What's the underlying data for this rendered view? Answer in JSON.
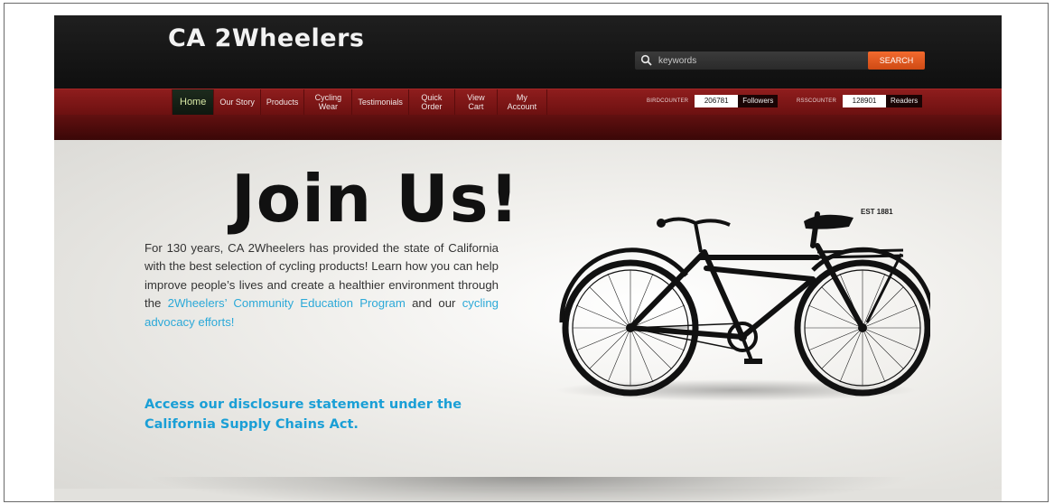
{
  "site": {
    "logo": "CA 2Wheelers"
  },
  "search": {
    "placeholder": "keywords",
    "button_label": "SEARCH"
  },
  "nav": {
    "items": [
      {
        "label": "Home"
      },
      {
        "label": "Our Story"
      },
      {
        "label": "Products"
      },
      {
        "label": "Cycling Wear"
      },
      {
        "label": "Testimonials"
      },
      {
        "label": "Quick Order"
      },
      {
        "label": "View Cart"
      },
      {
        "label": "My Account"
      }
    ]
  },
  "counters": {
    "bird": {
      "label": "BIRDCOUNTER",
      "value": "206781",
      "tag": "Followers"
    },
    "rss": {
      "label": "RSSCOUNTER",
      "value": "128901",
      "tag": "Readers"
    }
  },
  "hero": {
    "title": "Join Us!",
    "para_part1": "For 130 years, CA 2Wheelers has provided the state of California with the best selection of cycling products! Learn how you can help improve people’s lives and create a healthier environment through the ",
    "link1": "2Wheelers’ Community Education Program",
    "para_part2": " and our ",
    "link2": "cycling advocacy efforts!",
    "disclosure": "Access our disclosure statement under the California Supply Chains Act.",
    "est": "EST 1881"
  },
  "colors": {
    "accent_orange": "#e35a1e",
    "nav_red": "#7d1616",
    "link_blue": "#2ca9d8",
    "disclosure_blue": "#1a9fd6"
  }
}
